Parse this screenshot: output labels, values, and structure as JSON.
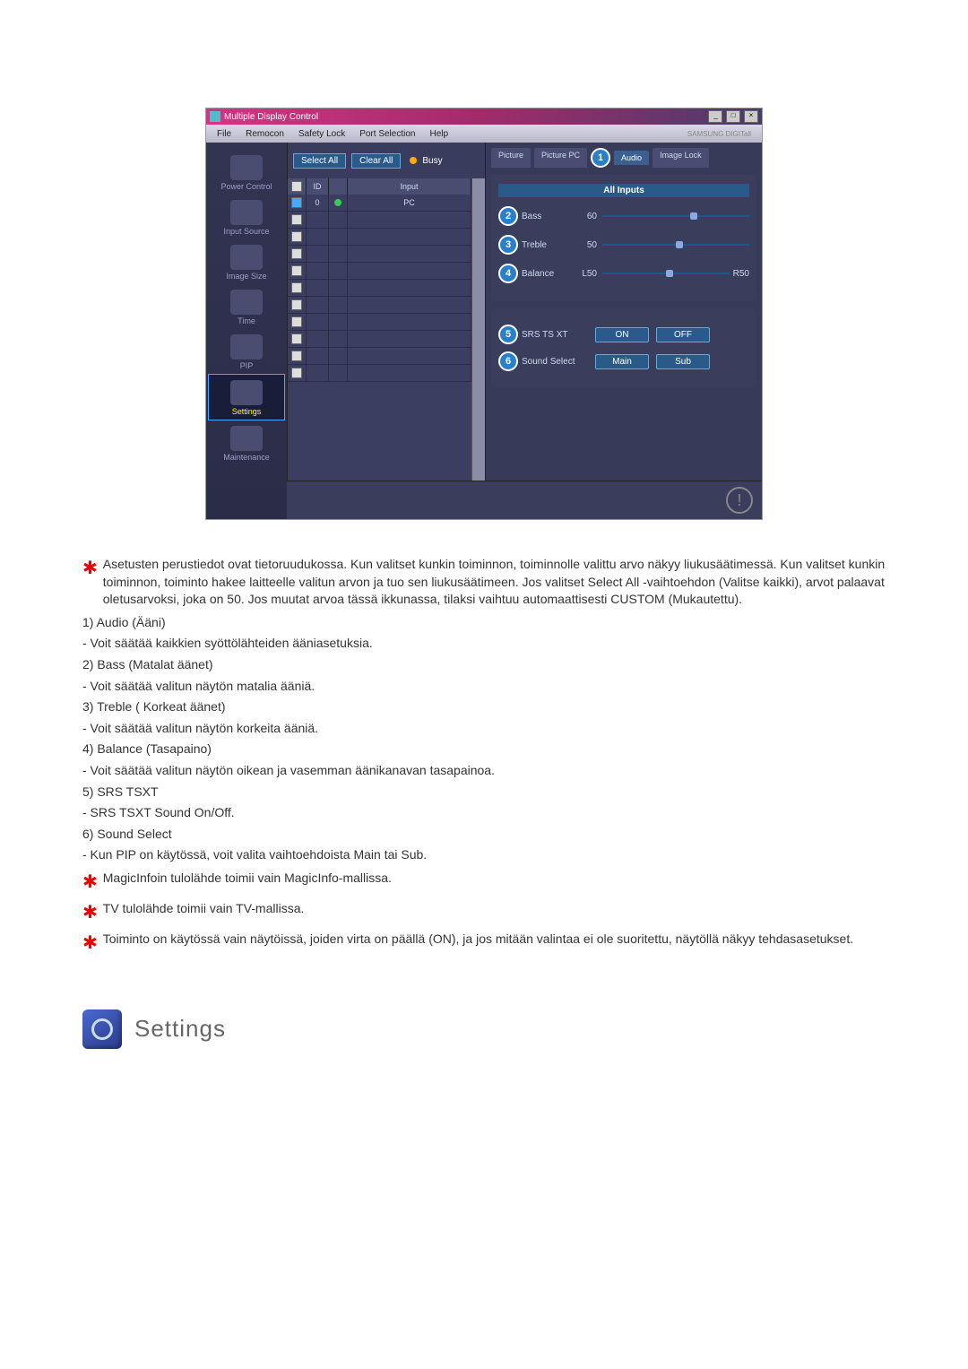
{
  "window": {
    "title": "Multiple Display Control",
    "brand": "SAMSUNG DIGITall"
  },
  "menu": [
    "File",
    "Remocon",
    "Safety Lock",
    "Port Selection",
    "Help"
  ],
  "sidebar": [
    {
      "label": "Power Control"
    },
    {
      "label": "Input Source"
    },
    {
      "label": "Image Size"
    },
    {
      "label": "Time"
    },
    {
      "label": "PIP"
    },
    {
      "label": "Settings"
    },
    {
      "label": "Maintenance"
    }
  ],
  "toolbar": {
    "select_all": "Select All",
    "clear_all": "Clear All",
    "busy": "Busy"
  },
  "grid": {
    "headers": {
      "id": "ID",
      "input": "Input"
    },
    "rows": [
      {
        "checked": true,
        "id": "0",
        "status": "on",
        "input": "PC"
      }
    ],
    "empty_rows": 10
  },
  "tabs": {
    "picture": "Picture",
    "picture_pc": "Picture PC",
    "audio": "Audio",
    "image_lock": "Image Lock"
  },
  "panel": {
    "header": "All Inputs",
    "sliders": [
      {
        "n": "2",
        "label": "Bass",
        "value": "60"
      },
      {
        "n": "3",
        "label": "Treble",
        "value": "50"
      },
      {
        "n": "4",
        "label": "Balance",
        "left": "L50",
        "right": "R50"
      }
    ],
    "buttons": [
      {
        "n": "5",
        "label": "SRS TS XT",
        "a": "ON",
        "b": "OFF"
      },
      {
        "n": "6",
        "label": "Sound Select",
        "a": "Main",
        "b": "Sub"
      }
    ],
    "audio_badge": "1"
  },
  "text": {
    "intro": "Asetusten perustiedot ovat tietoruudukossa. Kun valitset kunkin toiminnon, toiminnolle valittu arvo näkyy liukusäätimessä. Kun valitset kunkin toiminnon, toiminto hakee laitteelle valitun arvon ja tuo sen liukusäätimeen. Jos valitset Select All -vaihtoehdon (Valitse kaikki), arvot palaavat oletusarvoksi, joka on 50. Jos muutat arvoa tässä ikkunassa, tilaksi vaihtuu automaattisesti CUSTOM (Mukautettu).",
    "items": [
      {
        "num": "1)",
        "title": "Audio (Ääni)",
        "desc": "- Voit säätää kaikkien syöttölähteiden ääniasetuksia."
      },
      {
        "num": "2)",
        "title": "Bass (Matalat äänet)",
        "desc": "- Voit säätää valitun näytön matalia ääniä."
      },
      {
        "num": "3)",
        "title": "Treble ( Korkeat äänet)",
        "desc": "- Voit säätää valitun näytön korkeita ääniä."
      },
      {
        "num": "4)",
        "title": "Balance (Tasapaino)",
        "desc": "- Voit säätää valitun näytön oikean ja vasemman äänikanavan tasapainoa."
      },
      {
        "num": "5)",
        "title": "SRS TSXT",
        "desc": "- SRS TSXT Sound On/Off."
      },
      {
        "num": "6)",
        "title": "Sound Select",
        "desc": "- Kun PIP on käytössä, voit valita vaihtoehdoista Main tai Sub."
      }
    ],
    "notes": [
      "MagicInfoin tulolähde toimii vain MagicInfo-mallissa.",
      "TV tulolähde toimii vain TV-mallissa.",
      "Toiminto on käytössä vain näytöissä, joiden virta on päällä (ON), ja jos mitään valintaa ei ole suoritettu, näytöllä näkyy tehdasasetukset."
    ]
  },
  "section": {
    "title": "Settings"
  }
}
